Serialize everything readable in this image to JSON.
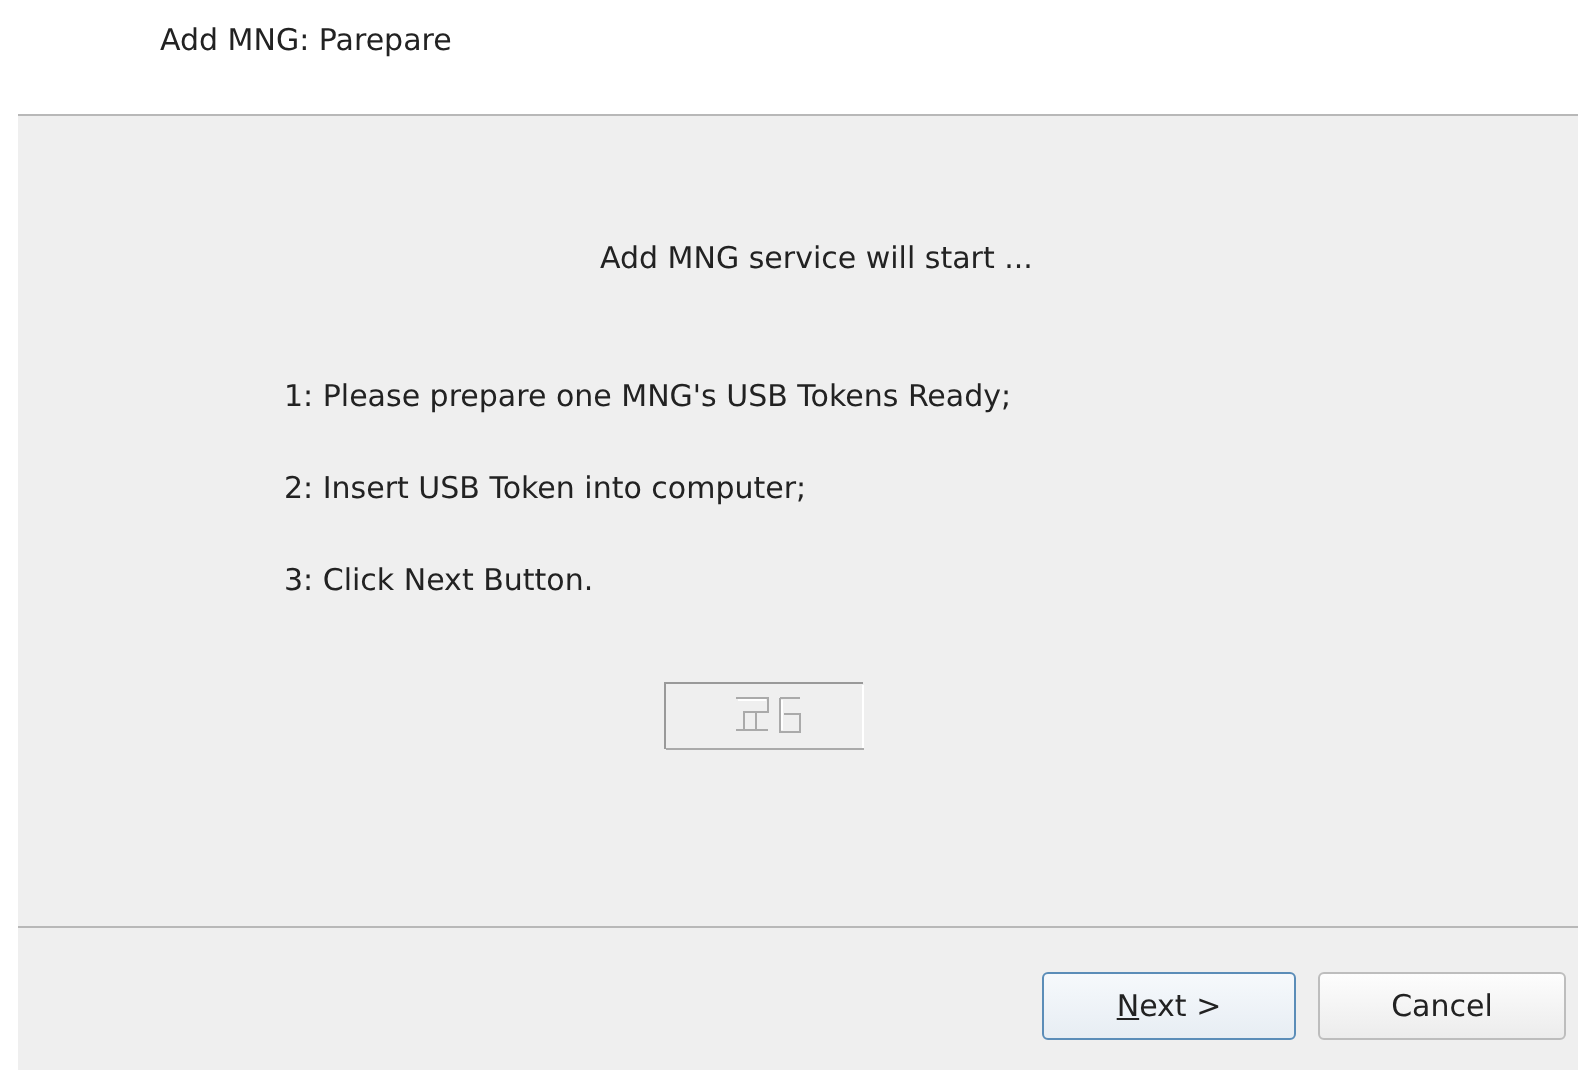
{
  "window": {
    "title": "Add MNG: Parepare"
  },
  "content": {
    "heading": "Add MNG service will start ...",
    "steps": [
      "1: Please prepare one MNG's USB Tokens Ready;",
      "2: Insert USB Token into computer;",
      "3: Click Next Button."
    ],
    "image": {
      "kind": "broken-image"
    }
  },
  "buttons": [
    {
      "kind": "default",
      "mnemonic": "N",
      "label_rest": "ext >"
    },
    {
      "kind": "normal",
      "label": "Cancel"
    }
  ]
}
